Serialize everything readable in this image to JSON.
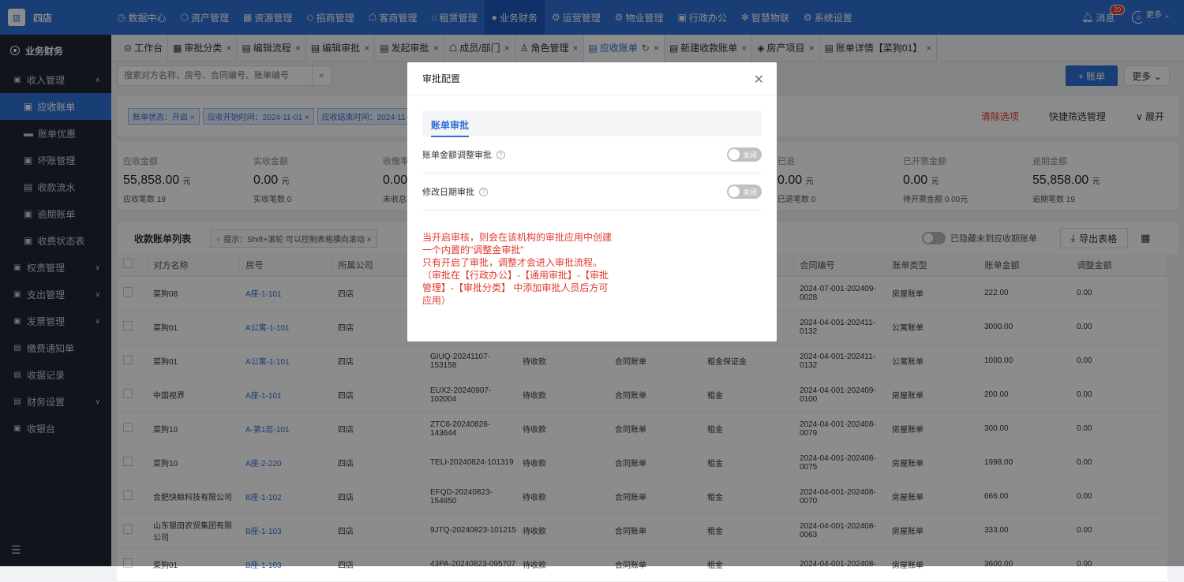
{
  "top": {
    "org": "四店",
    "nav": [
      "数据中心",
      "资产管理",
      "资源管理",
      "招商管理",
      "客商管理",
      "租赁管理",
      "业务财务",
      "运营管理",
      "物业管理",
      "行政办公",
      "智慧物联",
      "系统设置"
    ],
    "nav_icons": [
      "◷",
      "⬡",
      "▦",
      "◇",
      "☖",
      "⌂",
      "●",
      "⚙",
      "⚙",
      "▣",
      "✻",
      "⚙"
    ],
    "active_index": 6,
    "message": "消息",
    "message_count": "20",
    "user": "邵"
  },
  "sidebar": {
    "title": "业务财务",
    "items": [
      {
        "label": "收入管理",
        "icon": "▣",
        "expanded": true
      },
      {
        "label": "应收账单",
        "sub": true,
        "active": true,
        "icon": "▣"
      },
      {
        "label": "账单优惠",
        "sub": true,
        "icon": "▬"
      },
      {
        "label": "坏账管理",
        "sub": true,
        "icon": "▣"
      },
      {
        "label": "收款流水",
        "sub": true,
        "icon": "▤"
      },
      {
        "label": "逾期账单",
        "sub": true,
        "icon": "▣"
      },
      {
        "label": "收费状态表",
        "sub": true,
        "icon": "▣"
      },
      {
        "label": "权责管理",
        "icon": "▣",
        "chevron": true
      },
      {
        "label": "支出管理",
        "icon": "▣",
        "chevron": true
      },
      {
        "label": "发票管理",
        "icon": "▣",
        "chevron": true
      },
      {
        "label": "缴费通知单",
        "icon": "▤"
      },
      {
        "label": "收据记录",
        "icon": "▤"
      },
      {
        "label": "财务设置",
        "icon": "▤",
        "chevron": true
      },
      {
        "label": "收银台",
        "icon": "▣"
      }
    ]
  },
  "tabs": [
    {
      "label": "工作台",
      "icon": "⊙",
      "close": false
    },
    {
      "label": "审批分类",
      "icon": "▦",
      "close": true
    },
    {
      "label": "编辑流程",
      "icon": "▤",
      "close": true
    },
    {
      "label": "编辑审批",
      "icon": "▤",
      "close": true
    },
    {
      "label": "发起审批",
      "icon": "▤",
      "close": true
    },
    {
      "label": "成员/部门",
      "icon": "☖",
      "close": true
    },
    {
      "label": "角色管理",
      "icon": "♙",
      "close": true
    },
    {
      "label": "应收账单",
      "icon": "▤",
      "close": true,
      "active": true
    },
    {
      "label": "新建收款账单",
      "icon": "▤",
      "close": true
    },
    {
      "label": "房产项目",
      "icon": "◈",
      "close": true
    },
    {
      "label": "账单详情【菜狗01】",
      "icon": "▤",
      "close": true
    }
  ],
  "tabs_more": "更多 ⌄",
  "toolbar": {
    "search_placeholder": "搜索对方名称、房号、合同编号、账单编号",
    "add_label": "+ 账单",
    "more_label": "更多 ⌄"
  },
  "filters": {
    "chips": [
      "账单状态：开启 ×",
      "应收开始时间：2024-11-01 ×",
      "应收结束时间：2024-11-30"
    ],
    "clear": "清除选项",
    "quick": "快捷筛选管理",
    "expand": "∨ 展开"
  },
  "stats": [
    {
      "label": "应收金额",
      "value": "55,858.00",
      "unit": "元",
      "count": "应收笔数 19"
    },
    {
      "label": "实收金额",
      "value": "0.00",
      "unit": "元",
      "count": "实收笔数 0"
    },
    {
      "label": "收缴率",
      "value": "0.00",
      "unit": "",
      "count": "未收总笔"
    },
    {
      "label": "已退",
      "value": "0.00",
      "unit": "元",
      "count": "已退笔数 0"
    },
    {
      "label": "已开票金额",
      "value": "0.00",
      "unit": "元",
      "count": "待开票金额 0.00元"
    },
    {
      "label": "逾期金额",
      "value": "55,858.00",
      "unit": "元",
      "count": "逾期笔数 19"
    }
  ],
  "list": {
    "title": "收款账单列表",
    "hint": "提示：Shift+滚轮 可以控制表格横向滚动 ×",
    "hide_toggle_label": "已隐藏未到应收期账单",
    "export": "导出表格"
  },
  "table": {
    "headers": [
      "对方名称",
      "房号",
      "所属公司",
      "",
      "",
      "",
      "",
      "合同编号",
      "账单类型",
      "账单金额",
      "调整金额"
    ],
    "rows": [
      [
        "菜狗08",
        "A座-1-101",
        "四店",
        "",
        "",
        "",
        "",
        "2024-07-001-202409-0028",
        "房屋账单",
        "222.00",
        "0.00"
      ],
      [
        "菜狗01",
        "A公寓-1-101",
        "四店",
        "",
        "",
        "",
        "",
        "2024-04-001-202411-0132",
        "公寓账单",
        "3000.00",
        "0.00"
      ],
      [
        "菜狗01",
        "A公寓-1-101",
        "四店",
        "GIUQ-20241107-153158",
        "待收款",
        "合同账单",
        "租金保证金",
        "2024-04-001-202411-0132",
        "公寓账单",
        "1000.00",
        "0.00"
      ],
      [
        "中国视界",
        "A座-1-101",
        "四店",
        "EUX2-20240907-102004",
        "待收款",
        "合同账单",
        "租金",
        "2024-04-001-202409-0100",
        "房屋账单",
        "200.00",
        "0.00"
      ],
      [
        "菜狗10",
        "A-第1层-101",
        "四店",
        "ZTC6-20240826-143644",
        "待收款",
        "合同账单",
        "租金",
        "2024-04-001-202408-0079",
        "房屋账单",
        "300.00",
        "0.00"
      ],
      [
        "菜狗10",
        "A座-2-220",
        "四店",
        "TELI-20240824-101319",
        "待收款",
        "合同账单",
        "租金",
        "2024-04-001-202408-0075",
        "房屋账单",
        "1998.00",
        "0.00"
      ],
      [
        "合肥快鲸科技有限公司",
        "B座-1-102",
        "四店",
        "EFQD-20240823-154850",
        "待收款",
        "合同账单",
        "租金",
        "2024-04-001-202408-0070",
        "房屋账单",
        "666.00",
        "0.00"
      ],
      [
        "山东银田农贸集团有限公司",
        "B座-1-103",
        "四店",
        "9JTQ-20240823-101215",
        "待收款",
        "合同账单",
        "租金",
        "2024-04-001-202408-0063",
        "房屋账单",
        "333.00",
        "0.00"
      ],
      [
        "菜狗01",
        "B座-1-103",
        "四店",
        "43PA-20240823-095707",
        "待收款",
        "合同账单",
        "租金",
        "2024-04-001-202408-",
        "房屋账单",
        "3600.00",
        "0.00"
      ]
    ]
  },
  "modal": {
    "title": "审批配置",
    "section": "账单审批",
    "rows": [
      {
        "label": "账单金额调整审批",
        "switch": "关闭"
      },
      {
        "label": "修改日期审批",
        "switch": "关闭"
      }
    ],
    "note": "当开启审核，则会在该机构的审批应用中创建一个内置的\"调整金审批\"\n只有开启了审批，调整才会进入审批流程。（审批在【行政办公】-【通用审批】-【审批管理】-【审批分类】 中添加审批人员后方可应用）"
  }
}
